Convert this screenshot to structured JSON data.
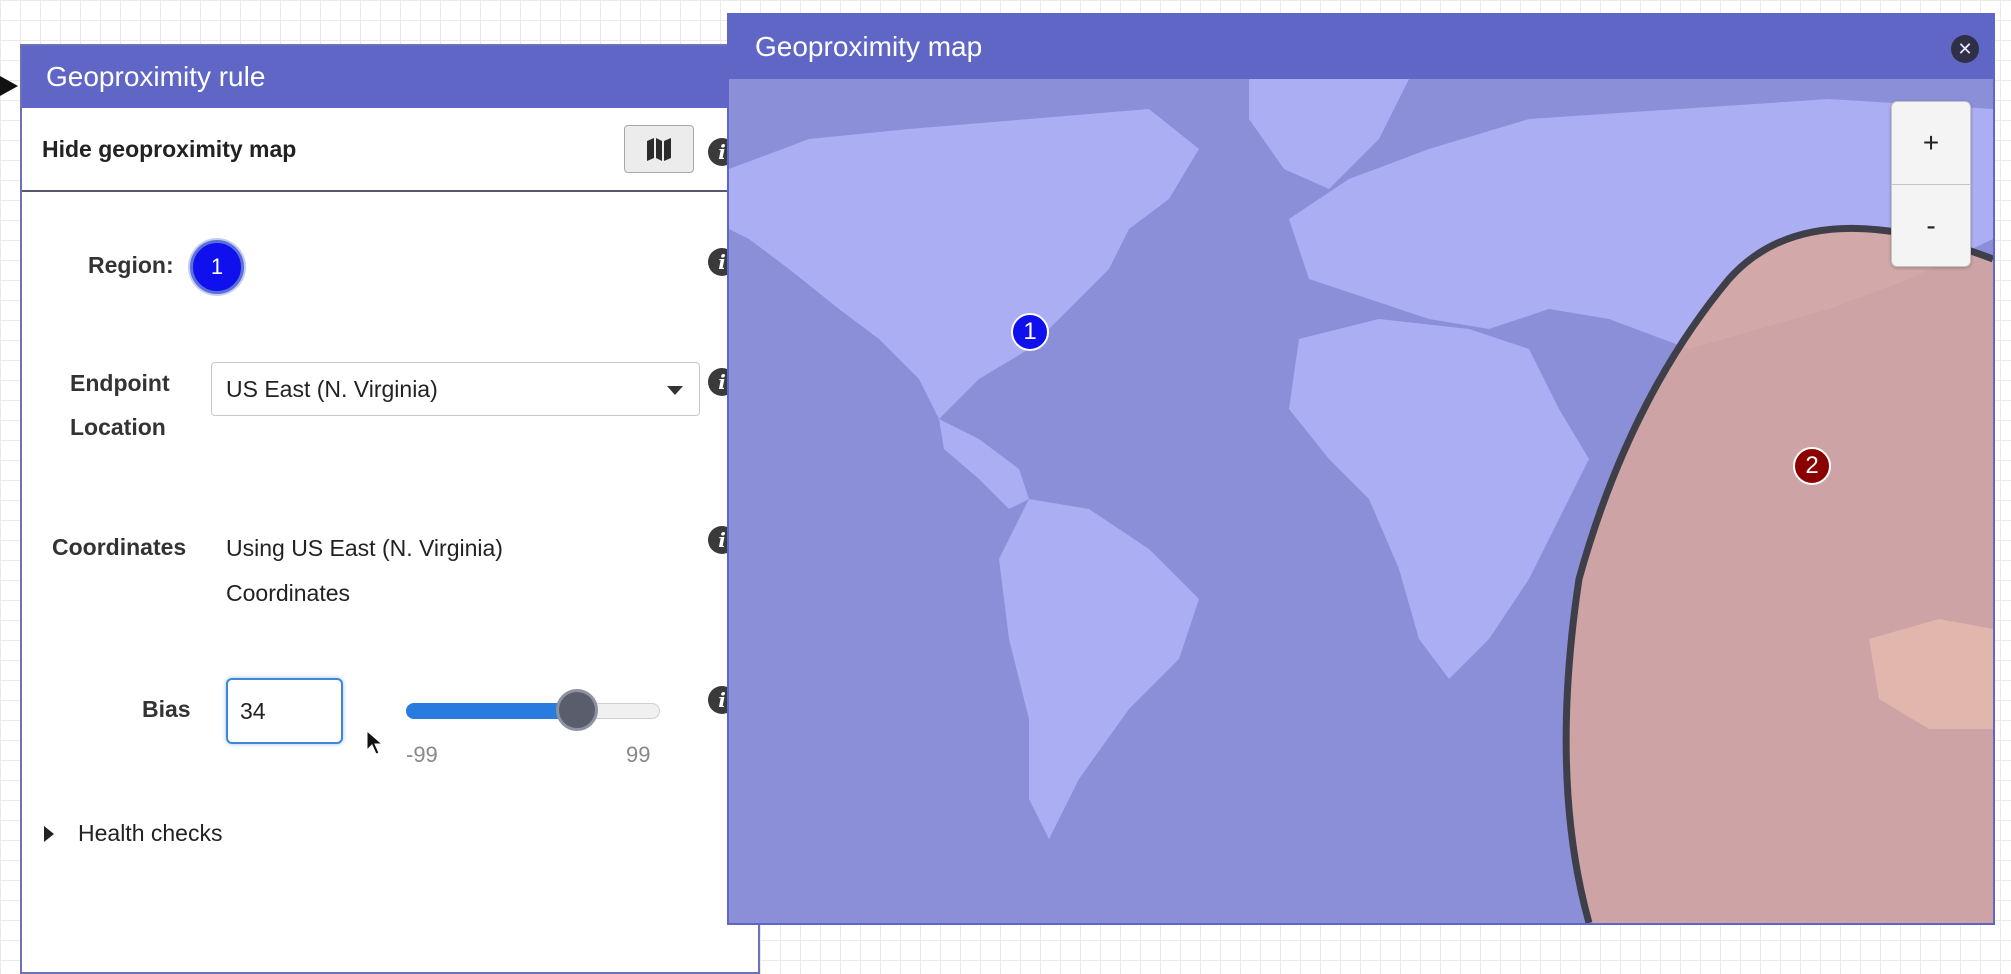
{
  "rule_panel": {
    "title": "Geoproximity rule",
    "hide_map_label": "Hide geoproximity map",
    "region_label": "Region:",
    "region_value": "1",
    "endpoint_label_line1": "Endpoint",
    "endpoint_label_line2": "Location",
    "endpoint_value": "US East (N. Virginia)",
    "coordinates_label": "Coordinates",
    "coordinates_line1": "Using US East (N. Virginia)",
    "coordinates_line2": "Coordinates",
    "bias_label": "Bias",
    "bias_value": "34",
    "slider_min": "-99",
    "slider_max": "99",
    "slider_value": 34,
    "health_checks_label": "Health checks"
  },
  "map_window": {
    "title": "Geoproximity map",
    "zoom_in": "+",
    "zoom_out": "-",
    "markers": [
      {
        "label": "1",
        "color": "#1010ee",
        "region": "US East (N. Virginia)"
      },
      {
        "label": "2",
        "color": "#8b0000",
        "region": "Asia Pacific"
      }
    ]
  },
  "colors": {
    "header": "#5f66c6",
    "ocean": "#8a8fd8",
    "land": "#abaef2",
    "region2_overlay": "#d9a79c",
    "slider_fill": "#2a7be0"
  }
}
